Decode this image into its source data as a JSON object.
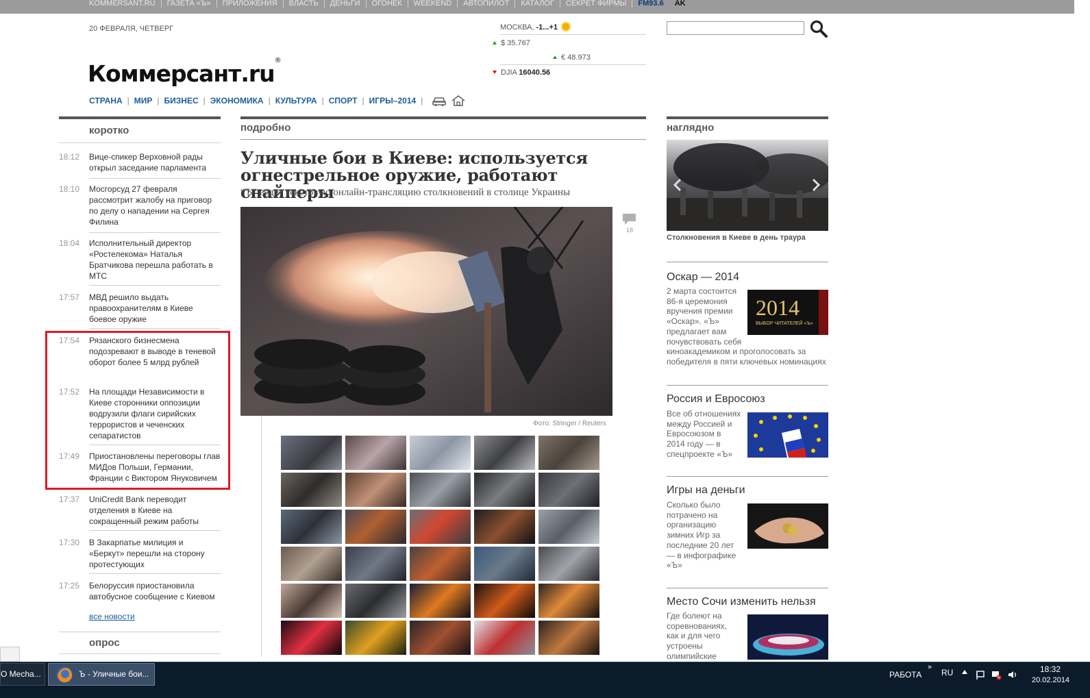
{
  "topbar": {
    "links": [
      "KOMMERSANT.RU",
      "ГАЗЕТА «Ъ»",
      "ПРИЛОЖЕНИЯ",
      "ВЛАСТЬ",
      "ДЕНЬГИ",
      "ОГОНЕК",
      "WEEKEND",
      "АВТОПИЛОТ",
      "КАТАЛОГ",
      "СЕКРЕТ ФИРМЫ"
    ],
    "fm": "FM93.6",
    "ak": "AK"
  },
  "header": {
    "date": "20 ФЕВРАЛЯ, ЧЕТВЕРГ",
    "logo": "Коммерсант.ru",
    "logo_mark": "®",
    "weather_city": "МОСКВА,",
    "weather_temp": "-1...+1",
    "usd": "$ 35.767",
    "eur": "€ 48.973",
    "djia_label": "DJIA",
    "djia_value": "16040.56",
    "search_placeholder": ""
  },
  "nav": {
    "items": [
      "СТРАНА",
      "МИР",
      "БИЗНЕС",
      "ЭКОНОМИКА",
      "КУЛЬТУРА",
      "СПОРТ",
      "ИГРЫ–2014"
    ]
  },
  "left": {
    "heading": "коротко",
    "news": [
      {
        "time": "18:12",
        "text": "Вице-спикер Верховной рады открыл заседание парламента"
      },
      {
        "time": "18:10",
        "text": "Мосгорсуд 27 февраля рассмотрит жалобу на приговор по делу о нападении на Сергея Филина"
      },
      {
        "time": "18:04",
        "text": "Исполнительный директор «Ростелекома» Наталья Братчикова перешла работать в МТС"
      },
      {
        "time": "17:57",
        "text": "МВД решило выдать правоохранителям в Киеве боевое оружие"
      },
      {
        "time": "17:54",
        "text": "Рязанского бизнесмена подозревают в выводе в теневой оборот более 5 млрд рублей"
      },
      {
        "time": "17:52",
        "text": "На площади Независимости в Киеве сторонники оппозиции водрузили флаги сирийских террористов и чеченских сепаратистов"
      },
      {
        "time": "17:49",
        "text": "Приостановлены переговоры глав МИДов Польши, Германии, Франции с Виктором Януковичем"
      },
      {
        "time": "17:37",
        "text": "UniCredit Bank переводит отделения в Киеве на сокращенный режим работы"
      },
      {
        "time": "17:30",
        "text": "В Закарпатье милиция и «Беркут» перешли на сторону протестующих"
      },
      {
        "time": "17:25",
        "text": "Белоруссия приостановила автобусное сообщение с Киевом"
      }
    ],
    "all_news": "все новости",
    "poll_heading": "опрос"
  },
  "middle": {
    "heading": "подробно",
    "headline": "Уличные бои в Киеве: используется огнестрельное оружие, работают снайперы",
    "subhead": "“Ъ” ведет текстовую онлайн-трансляцию столкновений в столице Украины",
    "comment_count": "18",
    "photo_credit": "Фото: Stringer / Reuters"
  },
  "right": {
    "heading": "наглядно",
    "photo_caption": "Столкновения в Киеве в день траура",
    "blocks": [
      {
        "title": "Оскар — 2014",
        "text": [
          "2 марта состоится",
          "86-я церемония",
          "вручения премии",
          "«Оскар». «Ъ»",
          "предлагает вам",
          "почувствовать себя",
          "киноакадемиком и проголосовать за",
          "победителя в пяти ключевых номинациях"
        ],
        "img_title": "2014",
        "img_sub": "ВЫБОР ЧИТАТЕЛЕЙ «Ъ»"
      },
      {
        "title": "Россия и Евросоюз",
        "text": [
          "Все об отношениях",
          "между Россией и",
          "Евросоюзом в",
          "2014 году — в",
          "спецпроекте «Ъ»"
        ]
      },
      {
        "title": "Игры на деньги",
        "text": [
          "Сколько было",
          "потрачено на",
          "организацию",
          "зимних Игр за",
          "последние 20 лет",
          "— в инфографике",
          "«Ъ»"
        ]
      },
      {
        "title": "Место Сочи изменить нельзя",
        "text": [
          "Где болеют на",
          "соревнованиях,",
          "как и для чего",
          "устроены",
          "олимпийские"
        ]
      }
    ]
  },
  "taskbar": {
    "task1": "O Mecha...",
    "task2": "Ъ - Уличные бои...",
    "work": "РАБОТА",
    "chevron": "»",
    "lang": "RU",
    "time": "18:32",
    "date": "20.02.2014"
  },
  "colors": {
    "link": "#1d5d9b",
    "highlight": "#e01a22",
    "taskbar": "#0c1b2a"
  }
}
